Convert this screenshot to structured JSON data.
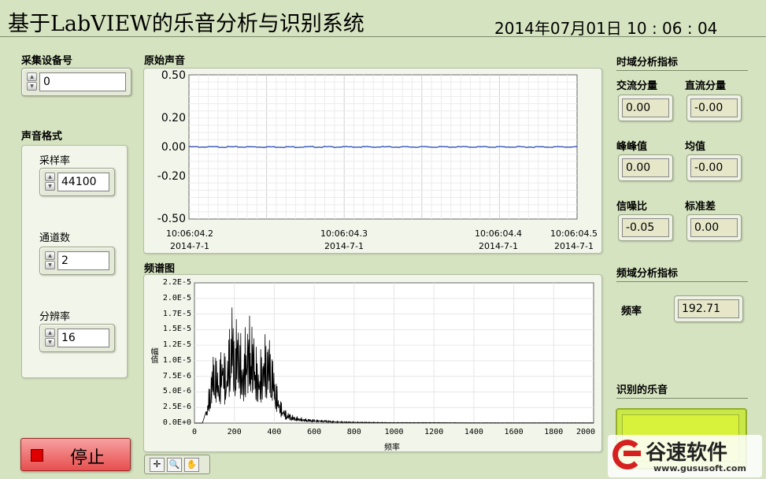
{
  "title": "基于LabVIEW的乐音分析与识别系统",
  "clock": "2014年07月01日  10 : 06 : 04",
  "device": {
    "label": "采集设备号",
    "value": "0"
  },
  "format": {
    "label": "声音格式",
    "sample_rate": {
      "label": "采样率",
      "value": "44100"
    },
    "channels": {
      "label": "通道数",
      "value": "2"
    },
    "resolution": {
      "label": "分辨率",
      "value": "16"
    }
  },
  "stop_label": "停止",
  "raw_chart": {
    "label": "原始声音",
    "y_ticks": [
      "0.50",
      "0.20",
      "0.00",
      "-0.20",
      "-0.50"
    ],
    "x_ticks": [
      {
        "time": "10:06:04.2",
        "date": "2014-7-1"
      },
      {
        "time": "10:06:04.3",
        "date": "2014-7-1"
      },
      {
        "time": "10:06:04.4",
        "date": "2014-7-1"
      },
      {
        "time": "10:06:04.5",
        "date": "2014-7-1"
      }
    ]
  },
  "spectrum_chart": {
    "label": "频谱图",
    "y_axis_label": "幅值",
    "x_axis_label": "频率",
    "y_ticks": [
      "2.2E-5",
      "2.0E-5",
      "1.7E-5",
      "1.5E-5",
      "1.2E-5",
      "1.0E-5",
      "7.5E-6",
      "5.0E-6",
      "2.5E-6",
      "0.0E+0"
    ],
    "x_ticks": [
      "0",
      "200",
      "400",
      "600",
      "800",
      "1000",
      "1200",
      "1400",
      "1600",
      "1800",
      "2000"
    ]
  },
  "time_domain": {
    "label": "时域分析指标",
    "ac": {
      "label": "交流分量",
      "value": "0.00"
    },
    "dc": {
      "label": "直流分量",
      "value": "-0.00"
    },
    "pp": {
      "label": "峰峰值",
      "value": "0.00"
    },
    "mean": {
      "label": "均值",
      "value": "-0.00"
    },
    "snr": {
      "label": "信噪比",
      "value": "-0.05"
    },
    "std": {
      "label": "标准差",
      "value": "0.00"
    }
  },
  "freq_domain": {
    "label": "频域分析指标",
    "freq": {
      "label": "频率",
      "value": "192.71"
    }
  },
  "recognized": {
    "label": "识别的乐音"
  },
  "watermark": {
    "name": "谷速软件",
    "url": "www.gususoft.com"
  },
  "chart_data": [
    {
      "type": "line",
      "title": "原始声音",
      "xlabel": "",
      "ylabel": "",
      "ylim": [
        -0.5,
        0.5
      ],
      "x": [
        "10:06:04.2",
        "10:06:04.3",
        "10:06:04.4",
        "10:06:04.5"
      ],
      "values": [
        0.0,
        0.0,
        0.0,
        0.0
      ],
      "grid": true
    },
    {
      "type": "line",
      "title": "频谱图",
      "xlabel": "频率",
      "ylabel": "幅值",
      "xlim": [
        0,
        2000
      ],
      "ylim": [
        0,
        2.2e-05
      ],
      "x": [
        0,
        40,
        60,
        80,
        100,
        120,
        140,
        160,
        180,
        190,
        200,
        210,
        220,
        240,
        260,
        280,
        300,
        320,
        340,
        360,
        380,
        400,
        420,
        440,
        460,
        500,
        550,
        600,
        650,
        700,
        800,
        900,
        1000,
        1100,
        1200,
        1400,
        1600,
        1800,
        2000
      ],
      "values": [
        0,
        0,
        2e-06,
        8e-06,
        1.3e-05,
        9e-06,
        1.4e-05,
        1e-05,
        1.8e-05,
        2.1e-05,
        1.4e-05,
        1.7e-05,
        1.9e-05,
        1.1e-05,
        1.7e-05,
        1.8e-05,
        1.5e-05,
        1e-05,
        1.3e-05,
        1.5e-05,
        1.4e-05,
        9e-06,
        5e-06,
        3e-06,
        2e-06,
        1.2e-06,
        8e-07,
        6e-07,
        5e-07,
        3e-07,
        2e-07,
        1.5e-07,
        1e-07,
        1e-07,
        1e-07,
        5e-08,
        5e-08,
        5e-08,
        5e-08
      ],
      "grid": true
    }
  ]
}
